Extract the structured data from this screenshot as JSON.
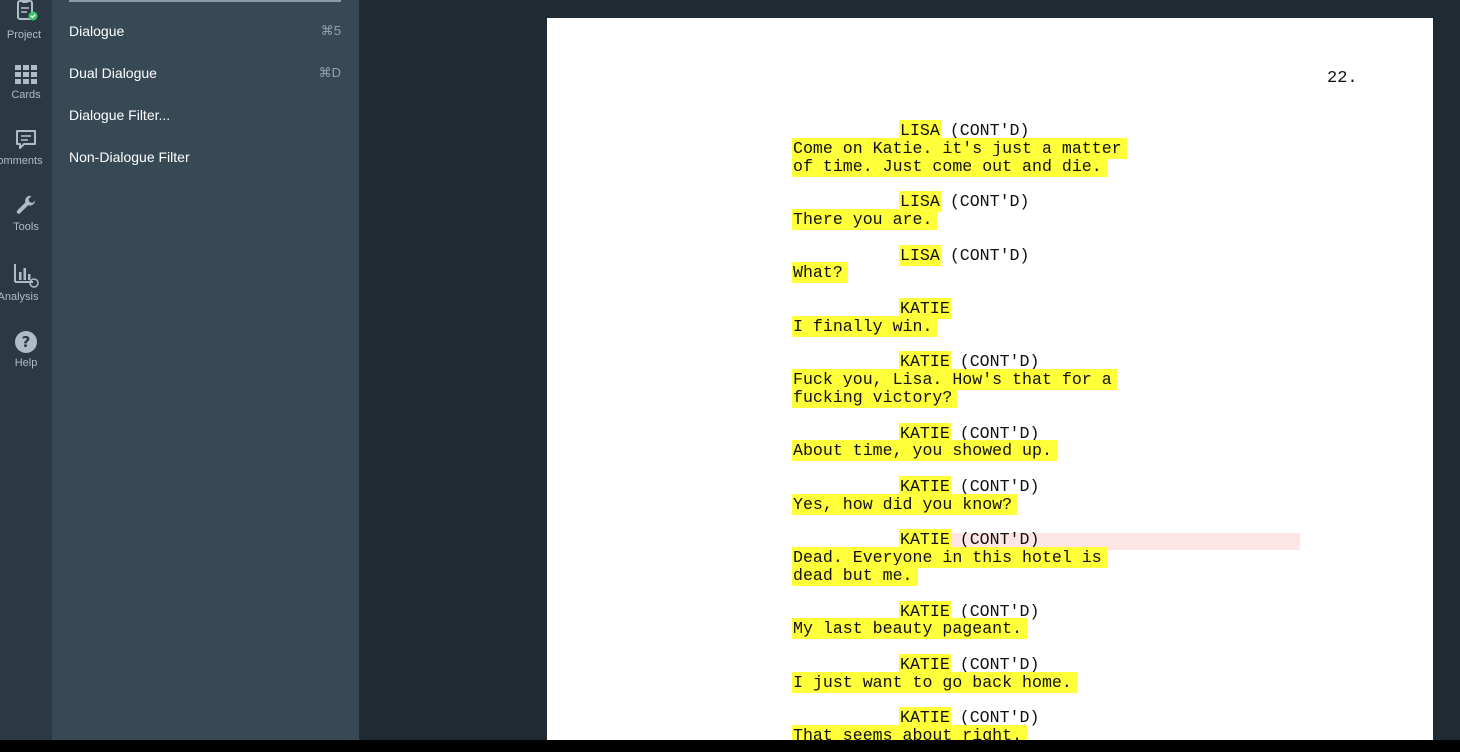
{
  "sidebar_rail": {
    "items": [
      {
        "label": "Project",
        "icon": "project-icon"
      },
      {
        "label": "Cards",
        "icon": "cards-icon"
      },
      {
        "label": "Comments",
        "icon": "comments-icon"
      },
      {
        "label": "Tools",
        "icon": "wrench-icon"
      },
      {
        "label": "Analysis",
        "icon": "analysis-icon"
      },
      {
        "label": "Help",
        "icon": "help-icon"
      }
    ]
  },
  "menu": {
    "items": [
      {
        "label": "Dialogue",
        "shortcut": "⌘5"
      },
      {
        "label": "Dual Dialogue",
        "shortcut": "⌘D"
      },
      {
        "label": "Dialogue Filter...",
        "shortcut": ""
      },
      {
        "label": "Non-Dialogue Filter",
        "shortcut": ""
      }
    ]
  },
  "page": {
    "number": "22.",
    "blocks": [
      {
        "character": "LISA",
        "ext": "(CONT'D)",
        "lines": [
          "Come on Katie. it's just a matter",
          "of time. Just come out and die."
        ]
      },
      {
        "character": "LISA",
        "ext": "(CONT'D)",
        "lines": [
          "There you are."
        ]
      },
      {
        "character": "LISA",
        "ext": "(CONT'D)",
        "lines": [
          "What?"
        ]
      },
      {
        "character": "KATIE",
        "ext": "",
        "lines": [
          "I finally win."
        ]
      },
      {
        "character": "KATIE",
        "ext": "(CONT'D)",
        "lines": [
          "Fuck you, Lisa. How's that for a",
          "fucking victory?"
        ]
      },
      {
        "character": "KATIE",
        "ext": "(CONT'D)",
        "lines": [
          "About time, you showed up."
        ]
      },
      {
        "character": "KATIE",
        "ext": "(CONT'D)",
        "lines": [
          "Yes, how did you know?"
        ]
      },
      {
        "character": "KATIE",
        "ext": "(CONT'D)",
        "lines": [
          "Dead. Everyone in this hotel is",
          "dead but me."
        ]
      },
      {
        "character": "KATIE",
        "ext": "(CONT'D)",
        "lines": [
          "My last beauty pageant."
        ]
      },
      {
        "character": "KATIE",
        "ext": "(CONT'D)",
        "lines": [
          "I just want to go back home."
        ]
      },
      {
        "character": "KATIE",
        "ext": "(CONT'D)",
        "lines": [
          "That seems about right."
        ]
      }
    ]
  },
  "colors": {
    "highlight": "#ffff3a",
    "rail_bg": "#2a3944",
    "menu_bg": "#364955",
    "app_bg": "#1f2a33",
    "current_line": "#fde5e5"
  }
}
